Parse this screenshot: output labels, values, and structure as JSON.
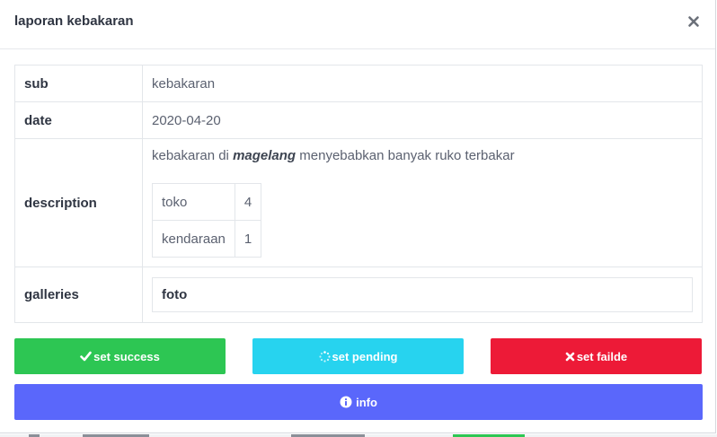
{
  "modal": {
    "title": "laporan kebakaran"
  },
  "details": {
    "sub": {
      "key": "sub",
      "value": "kebakaran"
    },
    "date": {
      "key": "date",
      "value": "2020-04-20"
    },
    "description": {
      "key": "description",
      "text_before": "kebakaran di ",
      "text_emphasis": "magelang",
      "text_after": " menyebabkan banyak ruko terbakar",
      "items": [
        {
          "name": "toko",
          "count": "4"
        },
        {
          "name": "kendaraan",
          "count": "1"
        }
      ]
    },
    "galleries": {
      "key": "galleries",
      "value": "foto"
    }
  },
  "actions": {
    "success_label": "set success",
    "pending_label": "set pending",
    "failed_label": "set failde",
    "info_label": "info"
  },
  "colors": {
    "success": "#2dc653",
    "pending": "#27d3ef",
    "failed": "#ed1a37",
    "info": "#5a67fb"
  }
}
